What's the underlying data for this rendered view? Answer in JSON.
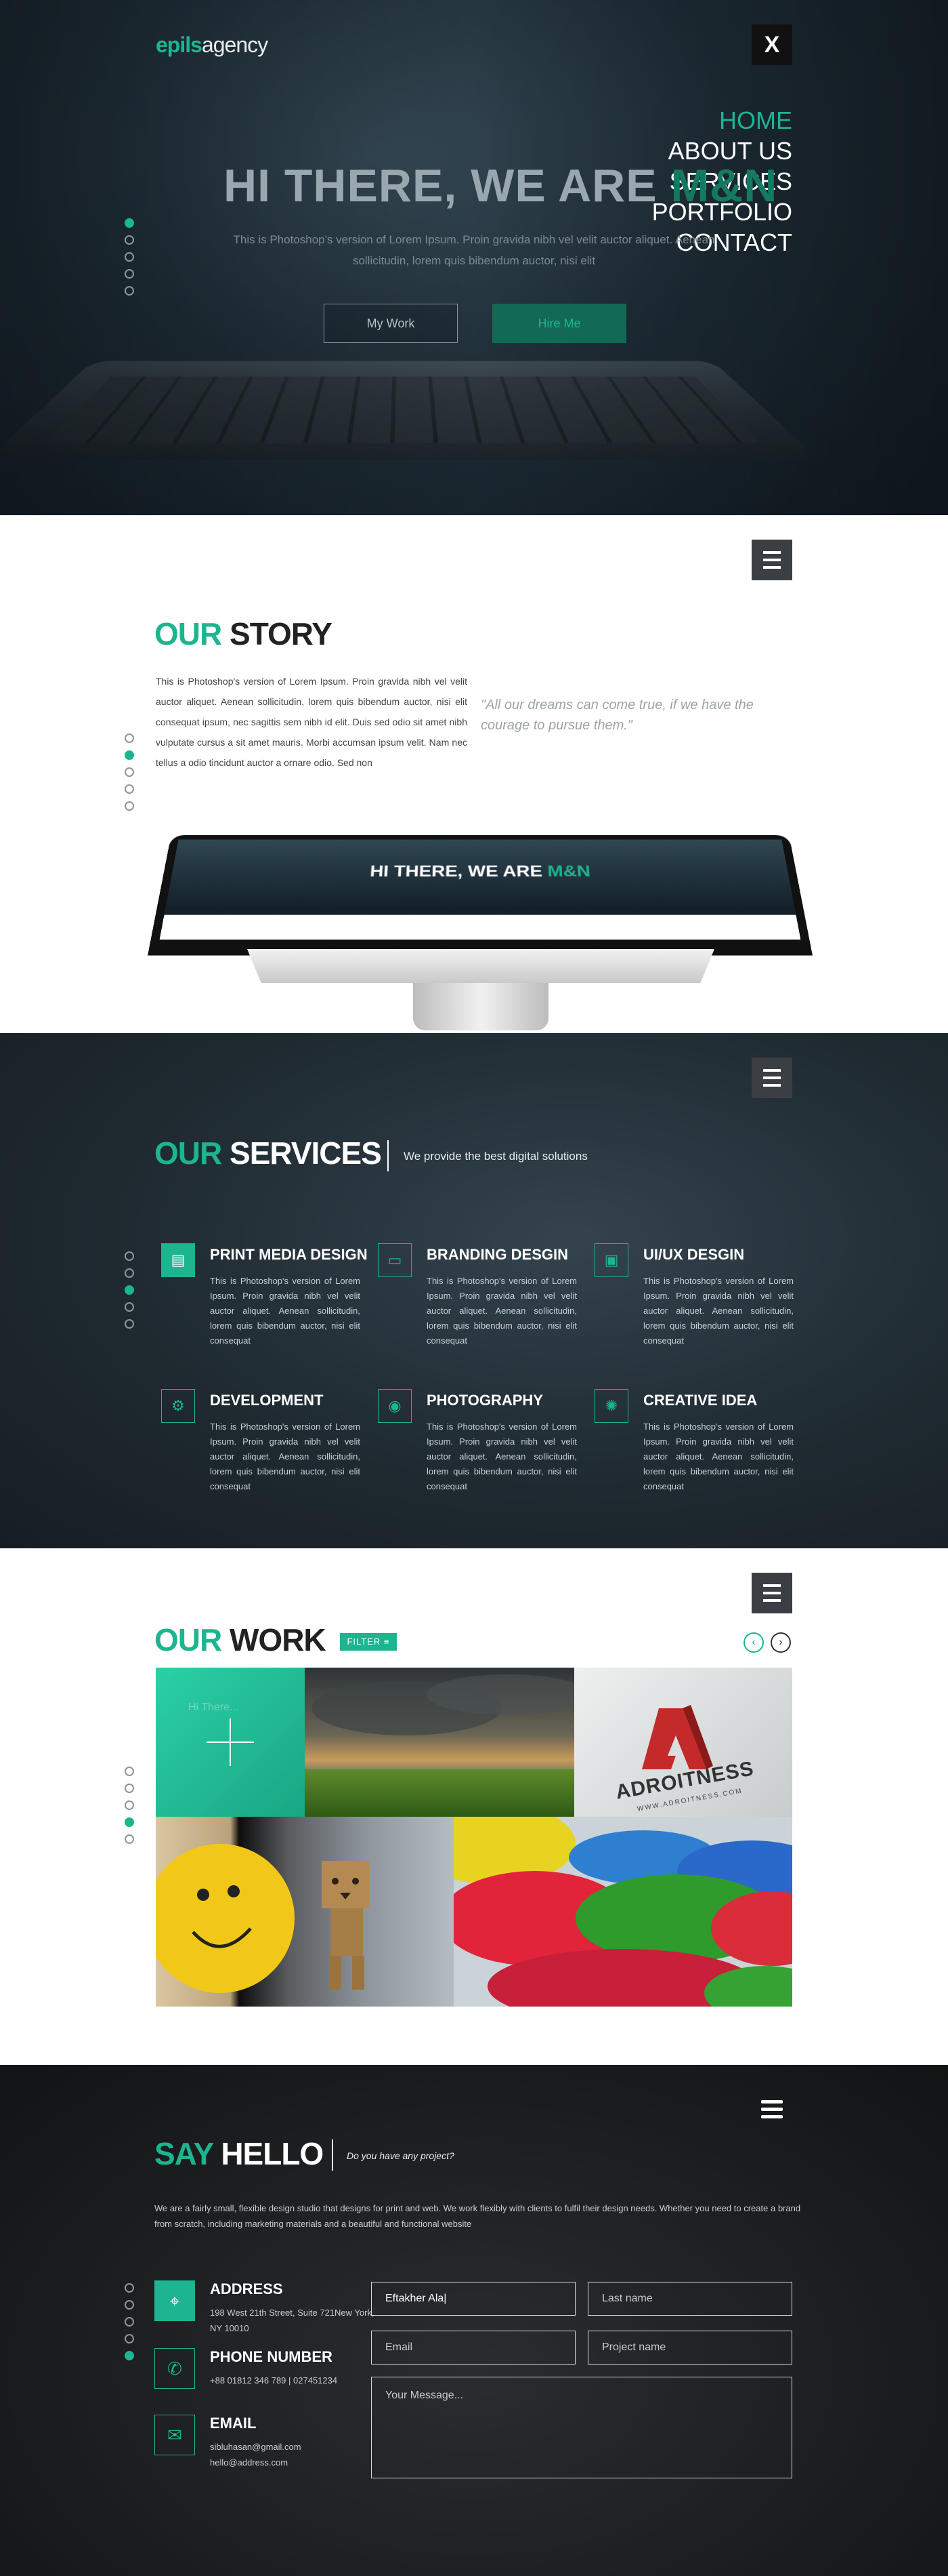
{
  "hero": {
    "logo_green": "epils",
    "logo_white": "agency",
    "close_label": "X",
    "nav": [
      "HOME",
      "ABOUT US",
      "SERVICES",
      "PORTFOLIO",
      "CONTACT"
    ],
    "title_main": "HI THERE, WE ARE ",
    "title_brand": "M&N",
    "subtitle": "This is Photoshop's version  of Lorem Ipsum. Proin gravida nibh vel velit auctor aliquet. Aenean sollicitudin, lorem quis bibendum auctor, nisi elit",
    "btn_work": "My Work",
    "btn_hire": "Hire Me"
  },
  "story": {
    "title_green": "OUR",
    "title_dark": "STORY",
    "text": "This is Photoshop's version  of Lorem Ipsum. Proin gravida nibh vel velit auctor aliquet. Aenean sollicitudin, lorem quis bibendum auctor, nisi elit consequat ipsum, nec sagittis sem nibh id elit. Duis sed odio sit amet nibh vulputate cursus a sit amet mauris. Morbi accumsan ipsum velit. Nam nec tellus a odio tincidunt auctor a ornare odio. Sed non",
    "quote": "\"All our dreams can come true, if we have the courage to pursue them.\"",
    "screen_title": "HI THERE, WE ARE ",
    "screen_brand": "M&N"
  },
  "services": {
    "title_green": "OUR",
    "title_white": "SERVICES",
    "subhead": "We provide the best digital solutions",
    "items": [
      {
        "icon": "print-icon",
        "glyph": "▤",
        "title": "PRINT MEDIA DESIGN",
        "text": "This is Photoshop's version of Lorem Ipsum. Proin gravida nibh vel velit auctor aliquet. Aenean sollicitudin, lorem quis bibendum auctor, nisi elit consequat"
      },
      {
        "icon": "monitor-icon",
        "glyph": "▭",
        "title": "BRANDING DESGIN",
        "text": "This is Photoshop's version of Lorem Ipsum. Proin gravida nibh vel velit auctor aliquet. Aenean sollicitudin, lorem quis bibendum auctor, nisi elit consequat"
      },
      {
        "icon": "chip-icon",
        "glyph": "▣",
        "title": "UI/UX DESGIN",
        "text": "This is Photoshop's version of Lorem Ipsum. Proin gravida nibh vel velit auctor aliquet. Aenean sollicitudin, lorem quis bibendum auctor, nisi elit consequat"
      },
      {
        "icon": "gear-icon",
        "glyph": "⚙",
        "title": "DEVELOPMENT",
        "text": "This is Photoshop's version of Lorem Ipsum. Proin gravida nibh vel velit auctor aliquet. Aenean sollicitudin, lorem quis bibendum auctor, nisi elit consequat"
      },
      {
        "icon": "camera-icon",
        "glyph": "◉",
        "title": "PHOTOGRAPHY",
        "text": "This is Photoshop's version of Lorem Ipsum. Proin gravida nibh vel velit auctor aliquet. Aenean sollicitudin, lorem quis bibendum auctor, nisi elit consequat"
      },
      {
        "icon": "lightbulb-icon",
        "glyph": "✺",
        "title": "CREATIVE IDEA",
        "text": "This is Photoshop's version of Lorem Ipsum. Proin gravida nibh vel velit auctor aliquet. Aenean sollicitudin, lorem quis bibendum auctor, nisi elit consequat"
      }
    ]
  },
  "work": {
    "title_green": "OUR",
    "title_dark": "WORK",
    "filter_label": "FILTER ≡",
    "prev": "‹",
    "next": "›",
    "overlay_text": "Hi There...",
    "logo_brand": "ADROITNESS",
    "logo_url": "WWW.ADROITNESS.COM"
  },
  "contact": {
    "title_green": "SAY",
    "title_white": "HELLO",
    "subhead": "Do you have any project?",
    "text": "We are a fairly small, flexible design studio that designs for print and web. We work flexibly with clients to fulfil their design needs. Whether you need to create a brand from scratch, including marketing materials and a beautiful and functional website",
    "address_label": "ADDRESS",
    "address_value": "198 West 21th Street, Suite 721New York, NY 10010",
    "phone_label": "PHONE NUMBER",
    "phone_value": "+88 01812 346 789  |  027451234",
    "email_label": "EMAIL",
    "email_value_1": "sibluhasan@gmail.com",
    "email_value_2": "hello@address.com",
    "first_name_value": "Eftakher Ala|",
    "last_name_placeholder": "Last name",
    "email_placeholder": "Email",
    "project_placeholder": "Project name",
    "message_placeholder": "Your Message..."
  },
  "colors": {
    "accent": "#1db58f",
    "dark": "#222222"
  }
}
